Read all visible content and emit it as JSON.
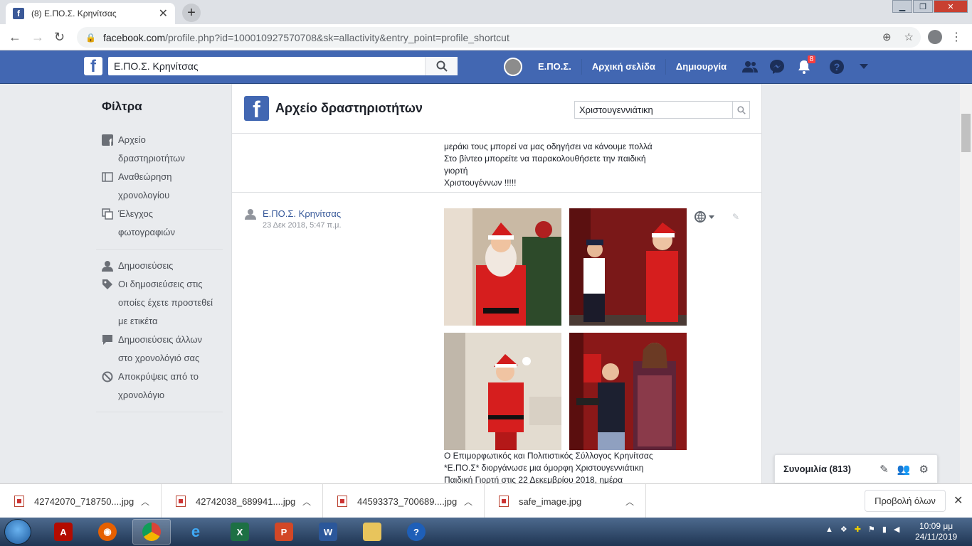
{
  "browser": {
    "tab_title": "(8) Ε.ΠΟ.Σ. Κρηνίτσας",
    "tab_close": "✕",
    "newtab_label": "+",
    "url_host": "facebook.com",
    "url_path": "/profile.php?id=100010927570708&sk=allactivity&entry_point=profile_shortcut"
  },
  "fb": {
    "search_value": "Ε.ΠΟ.Σ. Κρηνίτσας",
    "profile_name": "Ε.ΠΟ.Σ.",
    "home_label": "Αρχική σελίδα",
    "create_label": "Δημιουργία",
    "notifications_count": "8",
    "logo_letter": "f"
  },
  "filters": {
    "title": "Φίλτρα",
    "group1": [
      {
        "label": "Αρχείο δραστηριοτήτων",
        "line1": "Αρχείο",
        "line2": "δραστηριοτήτων",
        "icon": "facebook-icon"
      },
      {
        "label": "Αναθεώρηση χρονολογίου",
        "line1": "Αναθεώρηση",
        "line2": "χρονολογίου",
        "icon": "timeline-icon"
      },
      {
        "label": "Έλεγχος φωτογραφιών",
        "line1": "Έλεγχος",
        "line2": "φωτογραφιών",
        "icon": "photos-icon"
      }
    ],
    "group2": [
      {
        "line1": "Δημοσιεύσεις",
        "icon": "person-icon"
      },
      {
        "line1": "Οι δημοσιεύσεις στις",
        "line2": "οποίες έχετε προστεθεί",
        "line3": "με ετικέτα",
        "icon": "tag-icon"
      },
      {
        "line1": "Δημοσιεύσεις άλλων",
        "line2": "στο χρονολόγιό σας",
        "icon": "comment-icon"
      },
      {
        "line1": "Αποκρύψεις από το",
        "line2": "χρονολόγιο",
        "icon": "hidden-icon"
      }
    ]
  },
  "activity": {
    "title": "Αρχείο δραστηριοτήτων",
    "search_value": "Χριστουγεννιάτικη",
    "prev_post_lines": [
      "μεράκι τους μπορεί να μας οδηγήσει να κάνουμε πολλά",
      "Στο βίντεο μπορείτε να παρακολουθήσετε την παιδική",
      "γιορτή",
      "Χριστουγέννων !!!!!"
    ],
    "post": {
      "author": "Ε.ΠΟ.Σ. Κρηνίτσας",
      "date": "23 Δεκ 2018, 5:47 π.μ.",
      "privacy_icon": "globe-icon",
      "text_lines": [
        "Ο Επιμορφωτικός και Πολιτιστικός Σύλλογος Κρηνίτσας",
        "*Ε.ΠΟ.Σ* διοργάνωσε μια όμορφη Χριστουγεννιάτικη",
        "Παιδική Γιορτή στις 22 Δεκεμβρίου 2018, ημέρα"
      ]
    }
  },
  "chat": {
    "label": "Συνομιλία (813)"
  },
  "downloads": {
    "items": [
      "42742070_718750....jpg",
      "42742038_689941....jpg",
      "44593373_700689....jpg",
      "safe_image.jpg"
    ],
    "show_all": "Προβολή όλων"
  },
  "taskbar": {
    "time": "10:09 μμ",
    "date": "24/11/2019"
  }
}
